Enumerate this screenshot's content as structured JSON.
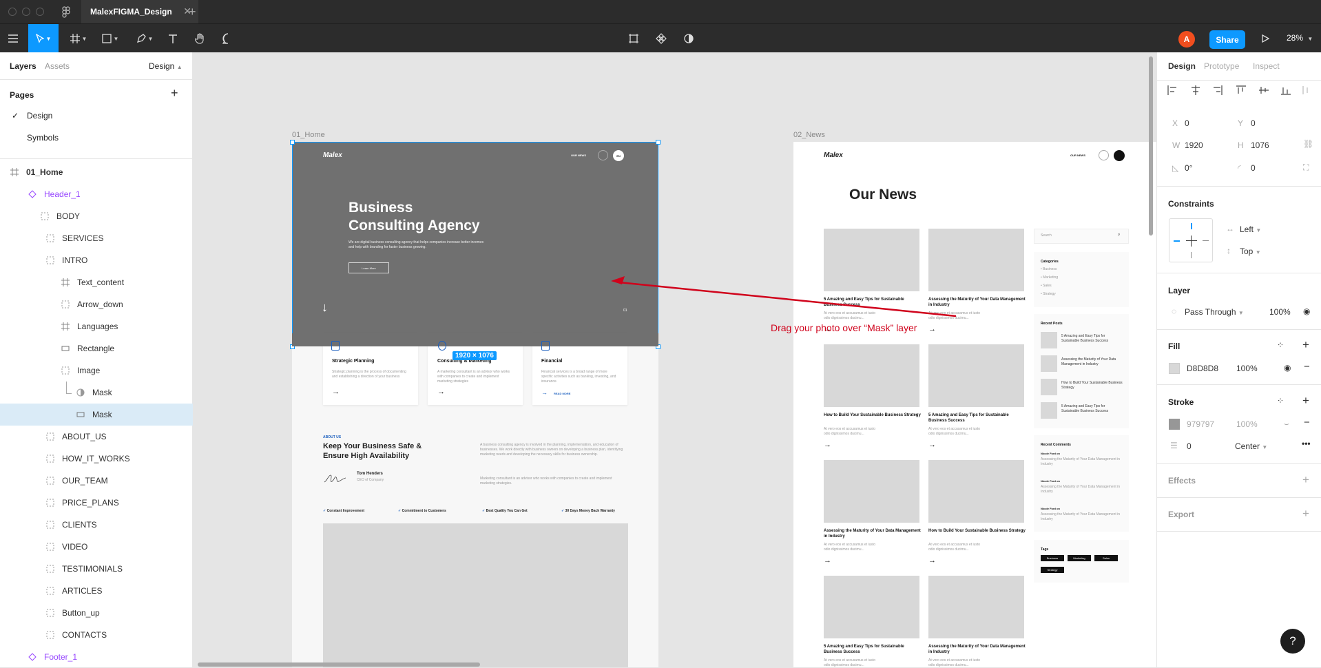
{
  "app": {
    "tab_title": "MalexFIGMA_Design",
    "zoom": "28%",
    "share_label": "Share",
    "avatar_initial": "A"
  },
  "left_panel": {
    "tabs": [
      "Layers",
      "Assets"
    ],
    "page_dropdown": "Design",
    "pages_header": "Pages",
    "pages": [
      "Design",
      "Symbols"
    ],
    "layers": [
      {
        "name": "01_Home",
        "icon": "frame-icon"
      },
      {
        "name": "Header_1",
        "icon": "component-instance-icon"
      },
      {
        "name": "BODY",
        "icon": "group-icon"
      },
      {
        "name": "SERVICES",
        "icon": "group-icon"
      },
      {
        "name": "INTRO",
        "icon": "group-icon"
      },
      {
        "name": "Text_content",
        "icon": "frame-icon"
      },
      {
        "name": "Arrow_down",
        "icon": "group-icon"
      },
      {
        "name": "Languages",
        "icon": "frame-icon"
      },
      {
        "name": "Rectangle",
        "icon": "rectangle-icon"
      },
      {
        "name": "Image",
        "icon": "group-icon"
      },
      {
        "name": "Mask",
        "icon": "mask-icon"
      },
      {
        "name": "Mask",
        "icon": "rectangle-icon"
      },
      {
        "name": "ABOUT_US",
        "icon": "group-icon"
      },
      {
        "name": "HOW_IT_WORKS",
        "icon": "group-icon"
      },
      {
        "name": "OUR_TEAM",
        "icon": "group-icon"
      },
      {
        "name": "PRICE_PLANS",
        "icon": "group-icon"
      },
      {
        "name": "CLIENTS",
        "icon": "group-icon"
      },
      {
        "name": "VIDEO",
        "icon": "group-icon"
      },
      {
        "name": "TESTIMONIALS",
        "icon": "group-icon"
      },
      {
        "name": "ARTICLES",
        "icon": "group-icon"
      },
      {
        "name": "Button_up",
        "icon": "group-icon"
      },
      {
        "name": "CONTACTS",
        "icon": "group-icon"
      },
      {
        "name": "Footer_1",
        "icon": "component-instance-icon"
      }
    ]
  },
  "canvas": {
    "frame1_label": "01_Home",
    "frame2_label": "02_News",
    "selection_size": "1920 × 1076",
    "annotation": "Drag your photo over “Mask” layer",
    "home": {
      "logo": "Malex",
      "nav": "OUR NEWS",
      "lang": "EN",
      "hero_title_1": "Business",
      "hero_title_2": "Consulting Agency",
      "hero_sub": "We are digital business consulting agency that helps companies increase better incomes and help with branding for faster business growing.",
      "hero_button": "Learn More",
      "slide_num": "01",
      "services": [
        {
          "title": "Strategic Planning",
          "text": "Strategic planning is the process of documenting and establishing a direction of your business"
        },
        {
          "title": "Consulting & Marketing",
          "text": "A marketing consultant is an advisor who works with companies to create and implement marketing strategies"
        },
        {
          "title": "Financial",
          "text": "Financial services is a broad range of more specific activities such as banking, investing, and insurance.",
          "link": "READ MORE"
        }
      ],
      "about_tag": "ABOUT US",
      "about_title": "Keep Your Business Safe & Ensure High Availability",
      "about_text_1": "A business consulting agency is involved in the planning, implementation, and education of businesses. We work directly with business owners on developing a business plan, identifying marketing needs and developing the necessary skills for business ownership.",
      "about_text_2": "Marketing consultant is an advisor who works with companies to create and implement marketing strategies.",
      "person_name": "Tom Henders",
      "person_role": "CEO of Company",
      "features": [
        "Constant Improvement",
        "Commitment to Customers",
        "Best Quality You Can Get",
        "30 Days Money Back Warranty"
      ]
    },
    "news": {
      "logo": "Malex",
      "nav": "OUR NEWS",
      "title": "Our News",
      "excerpt": "At vero eos et accusamus et iusto odio dignissimos ducimu...",
      "posts": [
        "5 Amazing and Easy Tips for Sustainable Business Success",
        "Assessing the Maturity of Your Data Management in Industry",
        "How to Build Your Sustainable Business Strategy",
        "5 Amazing and Easy Tips for Sustainable Business Success",
        "Assessing the Maturity of Your Data Management in Industry",
        "How to Build Your Sustainable Business Strategy",
        "5 Amazing and Easy Tips for Sustainable Business Success",
        "Assessing the Maturity of Your Data Management in Industry"
      ],
      "search_placeholder": "Search",
      "categories_title": "Categories",
      "categories": [
        "Business",
        "Marketing",
        "Sales",
        "Strategy"
      ],
      "recent_posts_title": "Recent Posts",
      "recent_posts": [
        "5 Amazing and Easy Tips for Sustainable Business Success",
        "Assessing the Maturity of Your Data Management in Industry",
        "How to Build Your Sustainable Business Strategy",
        "5 Amazing and Easy Tips for Sustainable Business Success"
      ],
      "recent_comments_title": "Recent Comments",
      "comment_author": "Nicole Ford on",
      "comment_text": "Assessing the Maturity of Your Data Management in Industry",
      "tags_title": "Tags",
      "tags": [
        "Business",
        "Marketing",
        "Sales",
        "Strategy"
      ]
    }
  },
  "right_panel": {
    "tabs": [
      "Design",
      "Prototype",
      "Inspect"
    ],
    "x_label": "X",
    "x": "0",
    "y_label": "Y",
    "y": "0",
    "w_label": "W",
    "w": "1920",
    "h_label": "H",
    "h": "1076",
    "rotation": "0°",
    "radius": "0",
    "constraints_header": "Constraints",
    "constraint_h": "Left",
    "constraint_v": "Top",
    "layer_header": "Layer",
    "blend": "Pass Through",
    "layer_opacity": "100%",
    "fill_header": "Fill",
    "fill_hex": "D8D8D8",
    "fill_opacity": "100%",
    "fill_color": "#d8d8d8",
    "stroke_header": "Stroke",
    "stroke_hex": "979797",
    "stroke_opacity": "100%",
    "stroke_color": "#979797",
    "stroke_weight": "0",
    "stroke_align": "Center",
    "effects_header": "Effects",
    "export_header": "Export"
  }
}
